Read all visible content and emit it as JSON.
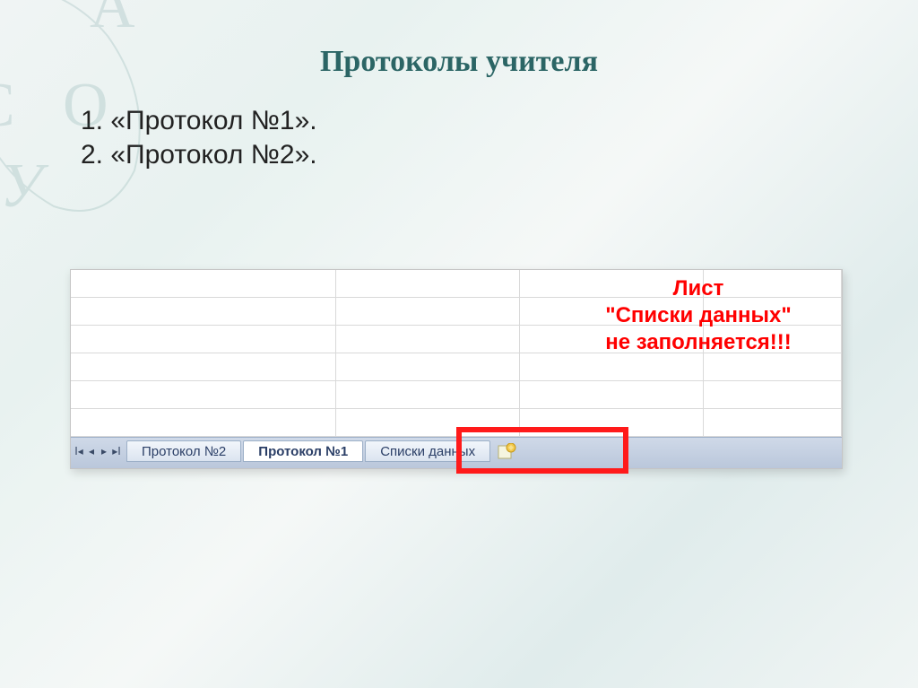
{
  "title": "Протоколы учителя",
  "list": {
    "item1_num": "1.",
    "item1_text": "«Протокол №1».",
    "item2_num": "2.",
    "item2_text": " «Протокол №2»."
  },
  "warning": {
    "line1": "Лист",
    "line2": "\"Списки данных\"",
    "line3": "не заполняется!!!"
  },
  "tabs": {
    "tab1": "Протокол №2",
    "tab2_active": "Протокол №1",
    "tab3": "Списки данных"
  },
  "nav": {
    "first": "ꓲ◂",
    "prev": "◂",
    "next": "▸",
    "last": "▸ꓲ"
  }
}
